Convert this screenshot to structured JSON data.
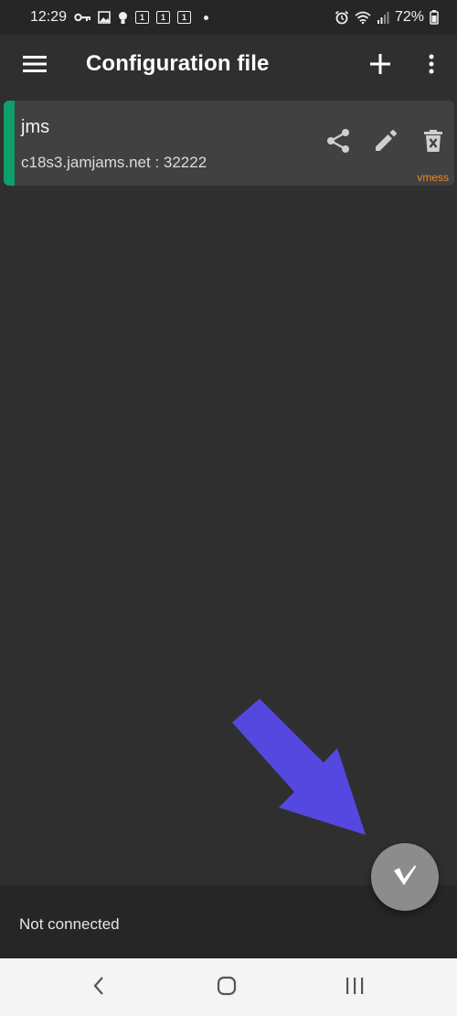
{
  "status_bar": {
    "time": "12:29",
    "sim_label": "1",
    "battery": "72%",
    "icons": [
      "key-icon",
      "image-icon",
      "bulb-icon",
      "sim-icon",
      "sim-icon",
      "sim-icon",
      "dot-icon",
      "alarm-icon",
      "wifi-icon",
      "signal-icon",
      "battery-icon"
    ]
  },
  "app_bar": {
    "title": "Configuration file",
    "icons": [
      "menu-icon",
      "plus-icon",
      "more-vert-icon"
    ]
  },
  "server": {
    "name": "jms",
    "address": "c18s3.jamjams.net : 32222",
    "type": "vmess",
    "accent_color": "#0f9d6a",
    "icons": [
      "share-icon",
      "edit-icon",
      "delete-icon"
    ]
  },
  "connection": {
    "status": "Not connected"
  },
  "fab": {
    "icon": "v-logo-icon",
    "color": "#8c8c8c"
  },
  "annotation": {
    "color": "#5448e0"
  },
  "nav_bar": {
    "icons": [
      "back-icon",
      "home-icon",
      "recents-icon"
    ]
  }
}
